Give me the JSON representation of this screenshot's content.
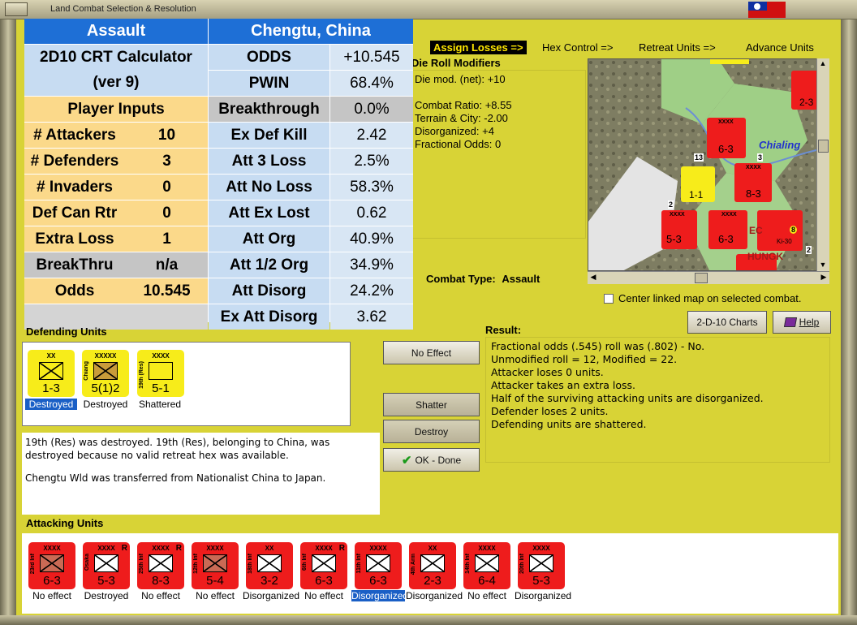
{
  "window": {
    "title": "Land Combat Selection & Resolution"
  },
  "crt": {
    "header_left": "Assault",
    "header_right": "Chengtu, China",
    "title_line1": "2D10 CRT Calculator",
    "title_line2": "(ver 9)",
    "player_inputs": "Player Inputs",
    "inputs": [
      {
        "label": "# Attackers",
        "value": "10"
      },
      {
        "label": "# Defenders",
        "value": "3"
      },
      {
        "label": "# Invaders",
        "value": "0"
      },
      {
        "label": "Def Can Rtr",
        "value": "0"
      },
      {
        "label": "Extra Loss",
        "value": "1"
      },
      {
        "label": "BreakThru",
        "value": "n/a"
      },
      {
        "label": "Odds",
        "value": "10.545"
      }
    ],
    "results": [
      {
        "label": "ODDS",
        "value": "+10.545"
      },
      {
        "label": "PWIN",
        "value": "68.4%"
      },
      {
        "label": "Breakthrough",
        "value": "0.0%"
      },
      {
        "label": "Ex Def Kill",
        "value": "2.42"
      },
      {
        "label": "Att 3 Loss",
        "value": "2.5%"
      },
      {
        "label": "Att No Loss",
        "value": "58.3%"
      },
      {
        "label": "Att Ex Lost",
        "value": "0.62"
      },
      {
        "label": "Att Org",
        "value": "40.9%"
      },
      {
        "label": "Att 1/2 Org",
        "value": "34.9%"
      },
      {
        "label": "Att Disorg",
        "value": "24.2%"
      },
      {
        "label": "Ex Att Disorg",
        "value": "3.62"
      }
    ]
  },
  "phases": {
    "active": "Assign Losses =>",
    "hex_control": "Hex Control =>",
    "retreat": "Retreat Units =>",
    "advance": "Advance Units"
  },
  "modifiers": {
    "title": "Die Roll Modifiers",
    "lines": [
      "Die mod. (net): +10",
      "",
      "Combat Ratio: +8.55",
      "Terrain & City: -2.00",
      "Disorganized: +4",
      "Fractional Odds: 0"
    ]
  },
  "map": {
    "label_chialing": "Chialing",
    "label_ec": "EC",
    "label_chungk": "HUNGK",
    "units": [
      {
        "size": "XXXX",
        "str": "6-3"
      },
      {
        "size": "XXXX",
        "str": "8-3"
      },
      {
        "size": "XXXX",
        "str": "5-3"
      },
      {
        "size": "XXXX",
        "str": "6-3"
      },
      {
        "size": "",
        "str": "1-1"
      },
      {
        "size": "",
        "str": "2-3"
      },
      {
        "size": "",
        "str": "Ki-30"
      }
    ],
    "stack_counts": {
      "center": "13",
      "left": "2",
      "right": "3",
      "ki": "8",
      "bottom": "2"
    }
  },
  "combat_type": {
    "label": "Combat Type:",
    "value": "Assault"
  },
  "center_map_label": "Center linked map on selected combat.",
  "buttons": {
    "charts": "2-D-10 Charts",
    "help": "Help",
    "no_effect": "No Effect",
    "shatter": "Shatter",
    "destroy": "Destroy",
    "ok": "OK - Done"
  },
  "defending": {
    "title": "Defending Units",
    "units": [
      {
        "size": "XX",
        "side": "",
        "str": "1-3",
        "status": "Destroyed"
      },
      {
        "size": "XXXXX",
        "side": "Chiang",
        "str": "5(1)2",
        "status": "Destroyed"
      },
      {
        "size": "XXXX",
        "side": "19th (Res)",
        "str": "5-1",
        "status": "Shattered"
      }
    ]
  },
  "message": {
    "line1": "19th (Res) was destroyed.  19th (Res), belonging to China, was destroyed because no valid retreat hex was available.",
    "line2": "Chengtu Wld was transferred from Nationalist China to Japan."
  },
  "result": {
    "title": "Result:",
    "lines": [
      "Fractional odds (.545) roll was (.802)  - No.",
      "Unmodified roll = 12, Modified = 22.",
      "Attacker loses 0 units.",
      "Attacker takes an extra loss.",
      "Half of the surviving attacking units are disorganized.",
      "Defender loses 2 units.",
      "Defending units are shattered."
    ]
  },
  "attacking": {
    "title": "Attacking Units",
    "units": [
      {
        "size": "XXXX",
        "side": "23rd Inf",
        "str": "6-3",
        "status": "No effect",
        "r": ""
      },
      {
        "size": "XXXX",
        "side": "Osaka",
        "str": "5-3",
        "status": "Destroyed",
        "r": "R"
      },
      {
        "size": "XXXX",
        "side": "25th Inf",
        "str": "8-3",
        "status": "No effect",
        "r": "R"
      },
      {
        "size": "XXXX",
        "side": "12th Inf",
        "str": "5-4",
        "status": "No effect",
        "r": ""
      },
      {
        "size": "XX",
        "side": "18th Inf",
        "str": "3-2",
        "status": "Disorganized",
        "r": ""
      },
      {
        "size": "XXXX",
        "side": "6th Inf",
        "str": "6-3",
        "status": "No effect",
        "r": "R"
      },
      {
        "size": "XXXX",
        "side": "11th Inf",
        "str": "6-3",
        "status": "Disorganized",
        "r": ""
      },
      {
        "size": "XX",
        "side": "4th Arm",
        "str": "2-3",
        "status": "Disorganized",
        "r": ""
      },
      {
        "size": "XXXX",
        "side": "14th Inf",
        "str": "6-4",
        "status": "No effect",
        "r": ""
      },
      {
        "size": "XXXX",
        "side": "20th Inf",
        "str": "5-3",
        "status": "Disorganized",
        "r": ""
      }
    ]
  }
}
